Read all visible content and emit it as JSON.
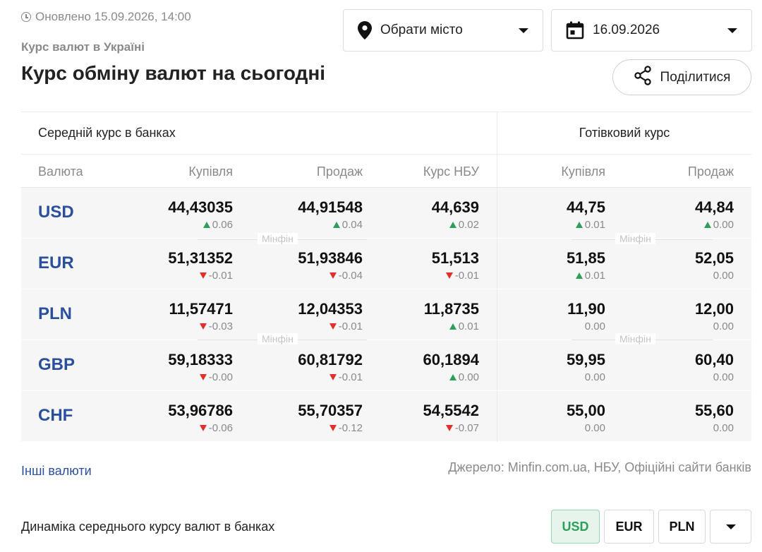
{
  "header": {
    "updated": "Оновлено 15.09.2026, 14:00",
    "breadcrumb": "Курс валют в Україні",
    "title": "Курс обміну валют на сьогодні",
    "clock_icon": "clock-icon"
  },
  "controls": {
    "city_label": "Обрати місто",
    "city_icon": "map-pin-icon",
    "date_label": "16.09.2026",
    "date_icon": "calendar-icon",
    "share_label": "Поділитися",
    "share_icon": "share-icon"
  },
  "table": {
    "group_avg": "Середній курс в банках",
    "group_cash": "Готівковий курс",
    "columns": [
      "Валюта",
      "Купівля",
      "Продаж",
      "Курс НБУ",
      "Купівля",
      "Продаж"
    ],
    "watermark": "Мінфін",
    "rows": [
      {
        "code": "USD",
        "cells": [
          {
            "val": "44,43035",
            "delta": "0.06",
            "dir": "up"
          },
          {
            "val": "44,91548",
            "delta": "0.04",
            "dir": "up"
          },
          {
            "val": "44,639",
            "delta": "0.02",
            "dir": "up"
          },
          {
            "val": "44,75",
            "delta": "0.01",
            "dir": "up"
          },
          {
            "val": "44,84",
            "delta": "0.00",
            "dir": "up"
          }
        ]
      },
      {
        "code": "EUR",
        "cells": [
          {
            "val": "51,31352",
            "delta": "-0.01",
            "dir": "down"
          },
          {
            "val": "51,93846",
            "delta": "-0.04",
            "dir": "down"
          },
          {
            "val": "51,513",
            "delta": "-0.01",
            "dir": "down"
          },
          {
            "val": "51,85",
            "delta": "0.01",
            "dir": "up"
          },
          {
            "val": "52,05",
            "delta": "0.00",
            "dir": "none"
          }
        ]
      },
      {
        "code": "PLN",
        "cells": [
          {
            "val": "11,57471",
            "delta": "-0.03",
            "dir": "down"
          },
          {
            "val": "12,04353",
            "delta": "-0.01",
            "dir": "down"
          },
          {
            "val": "11,8735",
            "delta": "0.01",
            "dir": "up"
          },
          {
            "val": "11,90",
            "delta": "0.00",
            "dir": "none"
          },
          {
            "val": "12,00",
            "delta": "0.00",
            "dir": "none"
          }
        ]
      },
      {
        "code": "GBP",
        "cells": [
          {
            "val": "59,18333",
            "delta": "-0.00",
            "dir": "down"
          },
          {
            "val": "60,81792",
            "delta": "-0.01",
            "dir": "down"
          },
          {
            "val": "60,1894",
            "delta": "0.00",
            "dir": "up"
          },
          {
            "val": "59,95",
            "delta": "0.00",
            "dir": "none"
          },
          {
            "val": "60,40",
            "delta": "0.00",
            "dir": "none"
          }
        ]
      },
      {
        "code": "CHF",
        "cells": [
          {
            "val": "53,96786",
            "delta": "-0.06",
            "dir": "down"
          },
          {
            "val": "55,70357",
            "delta": "-0.12",
            "dir": "down"
          },
          {
            "val": "54,5542",
            "delta": "-0.07",
            "dir": "down"
          },
          {
            "val": "55,00",
            "delta": "0.00",
            "dir": "none"
          },
          {
            "val": "55,60",
            "delta": "0.00",
            "dir": "none"
          }
        ]
      }
    ]
  },
  "footer": {
    "other_link": "Інші валюти",
    "source": "Джерело: Minfin.com.ua, НБУ, Офіційні сайти банків",
    "dynamics_title": "Динаміка середнього курсу валют в банках",
    "tabs": [
      "USD",
      "EUR",
      "PLN"
    ],
    "active_tab": "USD",
    "more_icon": "chevron-down-icon"
  },
  "colors": {
    "link": "#2a4f9c",
    "up": "#2e9e5b",
    "down": "#e0302a",
    "row_bg": "#f6f6f6"
  }
}
